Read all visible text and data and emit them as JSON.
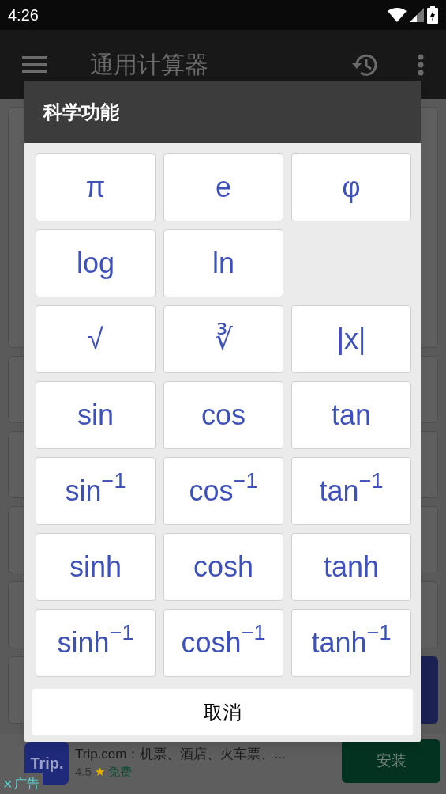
{
  "status_bar": {
    "time": "4:26"
  },
  "app_bar": {
    "title": "通用计算器"
  },
  "dialog": {
    "title": "科学功能",
    "functions": [
      {
        "kind": "key",
        "label": "π"
      },
      {
        "kind": "key",
        "label": "e"
      },
      {
        "kind": "key",
        "label": "φ"
      },
      {
        "kind": "key",
        "label": "log"
      },
      {
        "kind": "key",
        "label": "ln"
      },
      {
        "kind": "blank"
      },
      {
        "kind": "key",
        "label": "√"
      },
      {
        "kind": "key",
        "label": "∛"
      },
      {
        "kind": "key",
        "label": "|x|"
      },
      {
        "kind": "key",
        "label": "sin"
      },
      {
        "kind": "key",
        "label": "cos"
      },
      {
        "kind": "key",
        "label": "tan"
      },
      {
        "kind": "key",
        "label": "sin$^{−1}$"
      },
      {
        "kind": "key",
        "label": "cos$^{−1}$"
      },
      {
        "kind": "key",
        "label": "tan$^{−1}$"
      },
      {
        "kind": "key",
        "label": "sinh"
      },
      {
        "kind": "key",
        "label": "cosh"
      },
      {
        "kind": "key",
        "label": "tanh"
      },
      {
        "kind": "key",
        "label": "sinh$^{−1}$"
      },
      {
        "kind": "key",
        "label": "cosh$^{−1}$"
      },
      {
        "kind": "key",
        "label": "tanh$^{−1}$"
      }
    ],
    "cancel": "取消"
  },
  "ad": {
    "logo": "Trip.",
    "title": "Trip.com：机票、酒店、火车票、...",
    "rating": "4.5",
    "star": "★",
    "price": "免费",
    "install": "安装",
    "close": "×",
    "label": "广告"
  }
}
